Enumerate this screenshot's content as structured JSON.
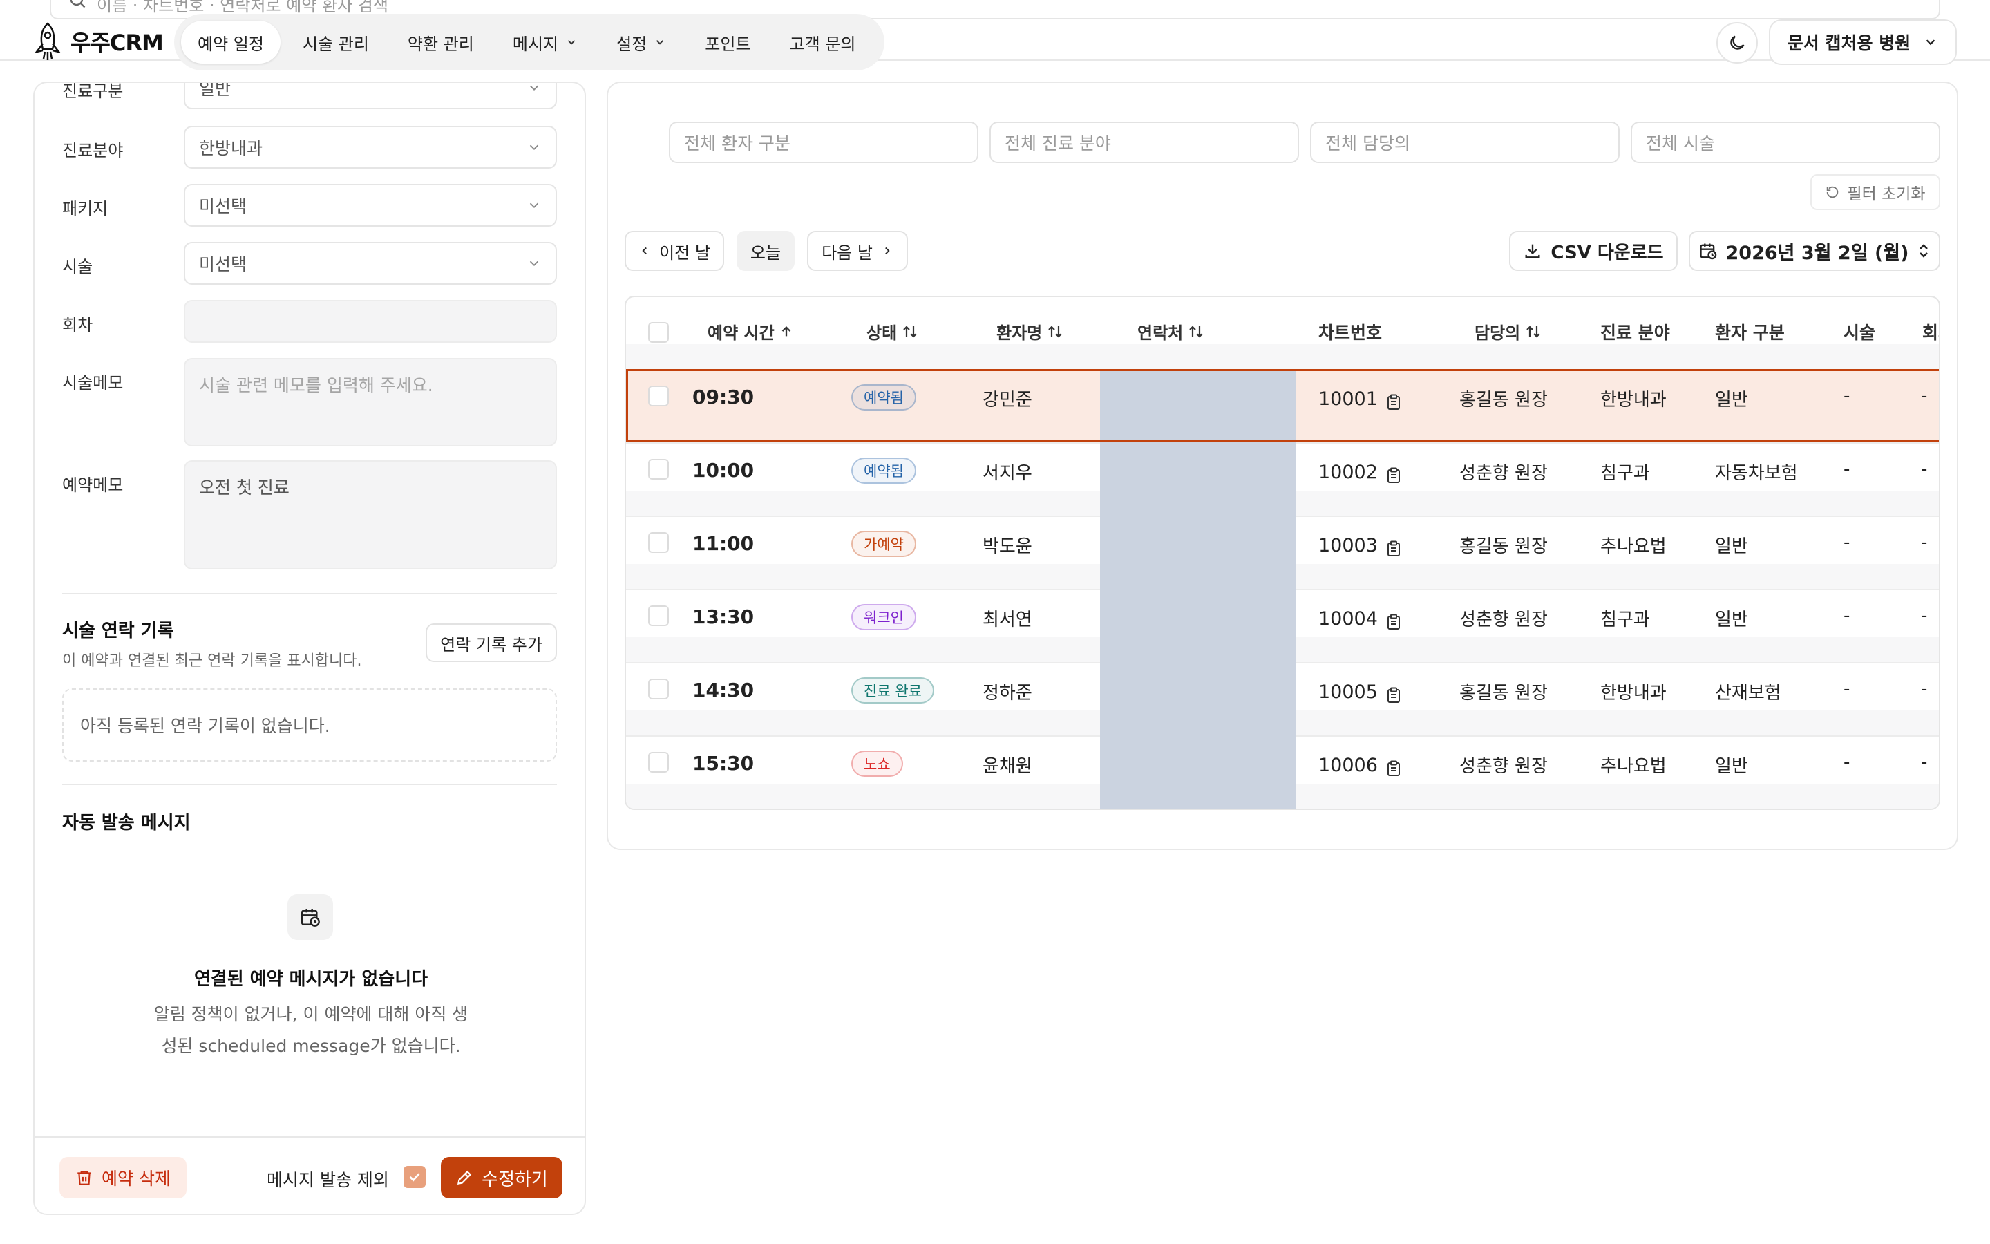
{
  "topSearch": {
    "placeholder": "이름 · 차트번호 · 연락처로 예약 환자 검색"
  },
  "brand": {
    "name": "우주CRM"
  },
  "nav": {
    "items": [
      {
        "label": "예약 일정",
        "active": true,
        "dropdown": false
      },
      {
        "label": "시술 관리",
        "active": false,
        "dropdown": false
      },
      {
        "label": "약환 관리",
        "active": false,
        "dropdown": false
      },
      {
        "label": "메시지",
        "active": false,
        "dropdown": true
      },
      {
        "label": "설정",
        "active": false,
        "dropdown": true
      },
      {
        "label": "포인트",
        "active": false,
        "dropdown": false
      },
      {
        "label": "고객 문의",
        "active": false,
        "dropdown": false
      }
    ],
    "hospital": "문서 캡처용 병원"
  },
  "form": {
    "visitType": {
      "label": "진료구분",
      "value": "일반"
    },
    "department": {
      "label": "진료분야",
      "value": "한방내과"
    },
    "package": {
      "label": "패키지",
      "value": "미선택"
    },
    "treatment": {
      "label": "시술",
      "value": "미선택"
    },
    "session": {
      "label": "회차",
      "value": ""
    },
    "treatmentMemo": {
      "label": "시술메모",
      "placeholder": "시술 관련 메모를 입력해 주세요."
    },
    "reservationMemo": {
      "label": "예약메모",
      "value": "오전 첫 진료"
    }
  },
  "contactLog": {
    "title": "시술 연락 기록",
    "subtitle": "이 예약과 연결된 최근 연락 기록을 표시합니다.",
    "addButton": "연락 기록 추가",
    "empty": "아직 등록된 연락 기록이 없습니다."
  },
  "autoMessage": {
    "title": "자동 발송 메시지",
    "emptyTitle": "연결된 예약 메시지가 없습니다",
    "emptyLine1": "알림 정책이 없거나, 이 예약에 대해 아직 생",
    "emptyLine2": "성된 scheduled message가 없습니다."
  },
  "footer": {
    "deleteButton": "예약 삭제",
    "excludeLabel": "메시지 발송 제외",
    "excludeChecked": true,
    "editButton": "수정하기"
  },
  "filters": {
    "patientType": "전체 환자 구분",
    "department": "전체 진료 분야",
    "doctor": "전체 담당의",
    "treatment": "전체 시술",
    "reset": "필터 초기화"
  },
  "dateNav": {
    "prev": "이전 날",
    "today": "오늘",
    "next": "다음 날",
    "csv": "CSV 다운로드",
    "date": "2026년 3월 2일 (월)"
  },
  "table": {
    "headers": {
      "time": "예약 시간",
      "status": "상태",
      "name": "환자명",
      "contact": "연락처",
      "chart": "차트번호",
      "doctor": "담당의",
      "department": "진료 분야",
      "patientType": "환자 구분",
      "treatment": "시술",
      "session": "회차"
    },
    "statusColors": {
      "예약됨": "#2563a8",
      "가예약": "#c2410c",
      "워크인": "#7e22ce",
      "진료 완료": "#0f766e",
      "노쇼": "#dc2626"
    },
    "rows": [
      {
        "time": "09:30",
        "status": "예약됨",
        "name": "강민준",
        "chart": "10001",
        "doctor": "홍길동 원장",
        "department": "한방내과",
        "patientType": "일반",
        "treatment": "-",
        "session": "-",
        "selected": true
      },
      {
        "time": "10:00",
        "status": "예약됨",
        "name": "서지우",
        "chart": "10002",
        "doctor": "성춘향 원장",
        "department": "침구과",
        "patientType": "자동차보험",
        "treatment": "-",
        "session": "-",
        "selected": false
      },
      {
        "time": "11:00",
        "status": "가예약",
        "name": "박도윤",
        "chart": "10003",
        "doctor": "홍길동 원장",
        "department": "추나요법",
        "patientType": "일반",
        "treatment": "-",
        "session": "-",
        "selected": false
      },
      {
        "time": "13:30",
        "status": "워크인",
        "name": "최서연",
        "chart": "10004",
        "doctor": "성춘향 원장",
        "department": "침구과",
        "patientType": "일반",
        "treatment": "-",
        "session": "-",
        "selected": false
      },
      {
        "time": "14:30",
        "status": "진료 완료",
        "name": "정하준",
        "chart": "10005",
        "doctor": "홍길동 원장",
        "department": "한방내과",
        "patientType": "산재보험",
        "treatment": "-",
        "session": "-",
        "selected": false
      },
      {
        "time": "15:30",
        "status": "노쇼",
        "name": "윤채원",
        "chart": "10006",
        "doctor": "성춘향 원장",
        "department": "추나요법",
        "patientType": "일반",
        "treatment": "-",
        "session": "-",
        "selected": false
      }
    ]
  }
}
